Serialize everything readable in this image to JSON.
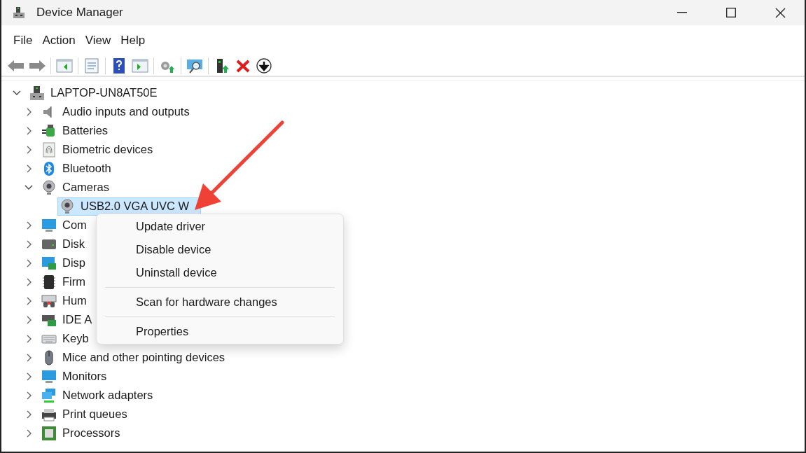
{
  "window": {
    "title": "Device Manager"
  },
  "menu_bar": [
    "File",
    "Action",
    "View",
    "Help"
  ],
  "tree": {
    "label": "LAPTOP-UN8AT50E",
    "expanded": true,
    "children": [
      {
        "label": "Audio inputs and outputs",
        "expanded": false,
        "selected": false
      },
      {
        "label": "Batteries",
        "expanded": false,
        "selected": false
      },
      {
        "label": "Biometric devices",
        "expanded": false,
        "selected": false
      },
      {
        "label": "Bluetooth",
        "expanded": false,
        "selected": false
      },
      {
        "label": "Cameras",
        "expanded": true,
        "selected": false,
        "children": [
          {
            "label": "USB2.0 VGA UVC W",
            "selected": true
          }
        ]
      },
      {
        "label": "Com",
        "expanded": false,
        "selected": false
      },
      {
        "label": "Disk",
        "expanded": false,
        "selected": false
      },
      {
        "label": "Disp",
        "expanded": false,
        "selected": false
      },
      {
        "label": "Firm",
        "expanded": false,
        "selected": false
      },
      {
        "label": "Hum",
        "expanded": false,
        "selected": false
      },
      {
        "label": "IDE A",
        "expanded": false,
        "selected": false
      },
      {
        "label": "Keyb",
        "expanded": false,
        "selected": false
      },
      {
        "label": "Mice and other pointing devices",
        "expanded": false,
        "selected": false
      },
      {
        "label": "Monitors",
        "expanded": false,
        "selected": false
      },
      {
        "label": "Network adapters",
        "expanded": false,
        "selected": false
      },
      {
        "label": "Print queues",
        "expanded": false,
        "selected": false
      },
      {
        "label": "Processors",
        "expanded": false,
        "selected": false
      }
    ]
  },
  "context_menu": {
    "items": [
      {
        "kind": "item",
        "label": "Update driver"
      },
      {
        "kind": "item",
        "label": "Disable device"
      },
      {
        "kind": "item",
        "label": "Uninstall device"
      },
      {
        "kind": "separator"
      },
      {
        "kind": "item",
        "label": "Scan for hardware changes"
      },
      {
        "kind": "separator"
      },
      {
        "kind": "item",
        "label": "Properties"
      }
    ]
  }
}
